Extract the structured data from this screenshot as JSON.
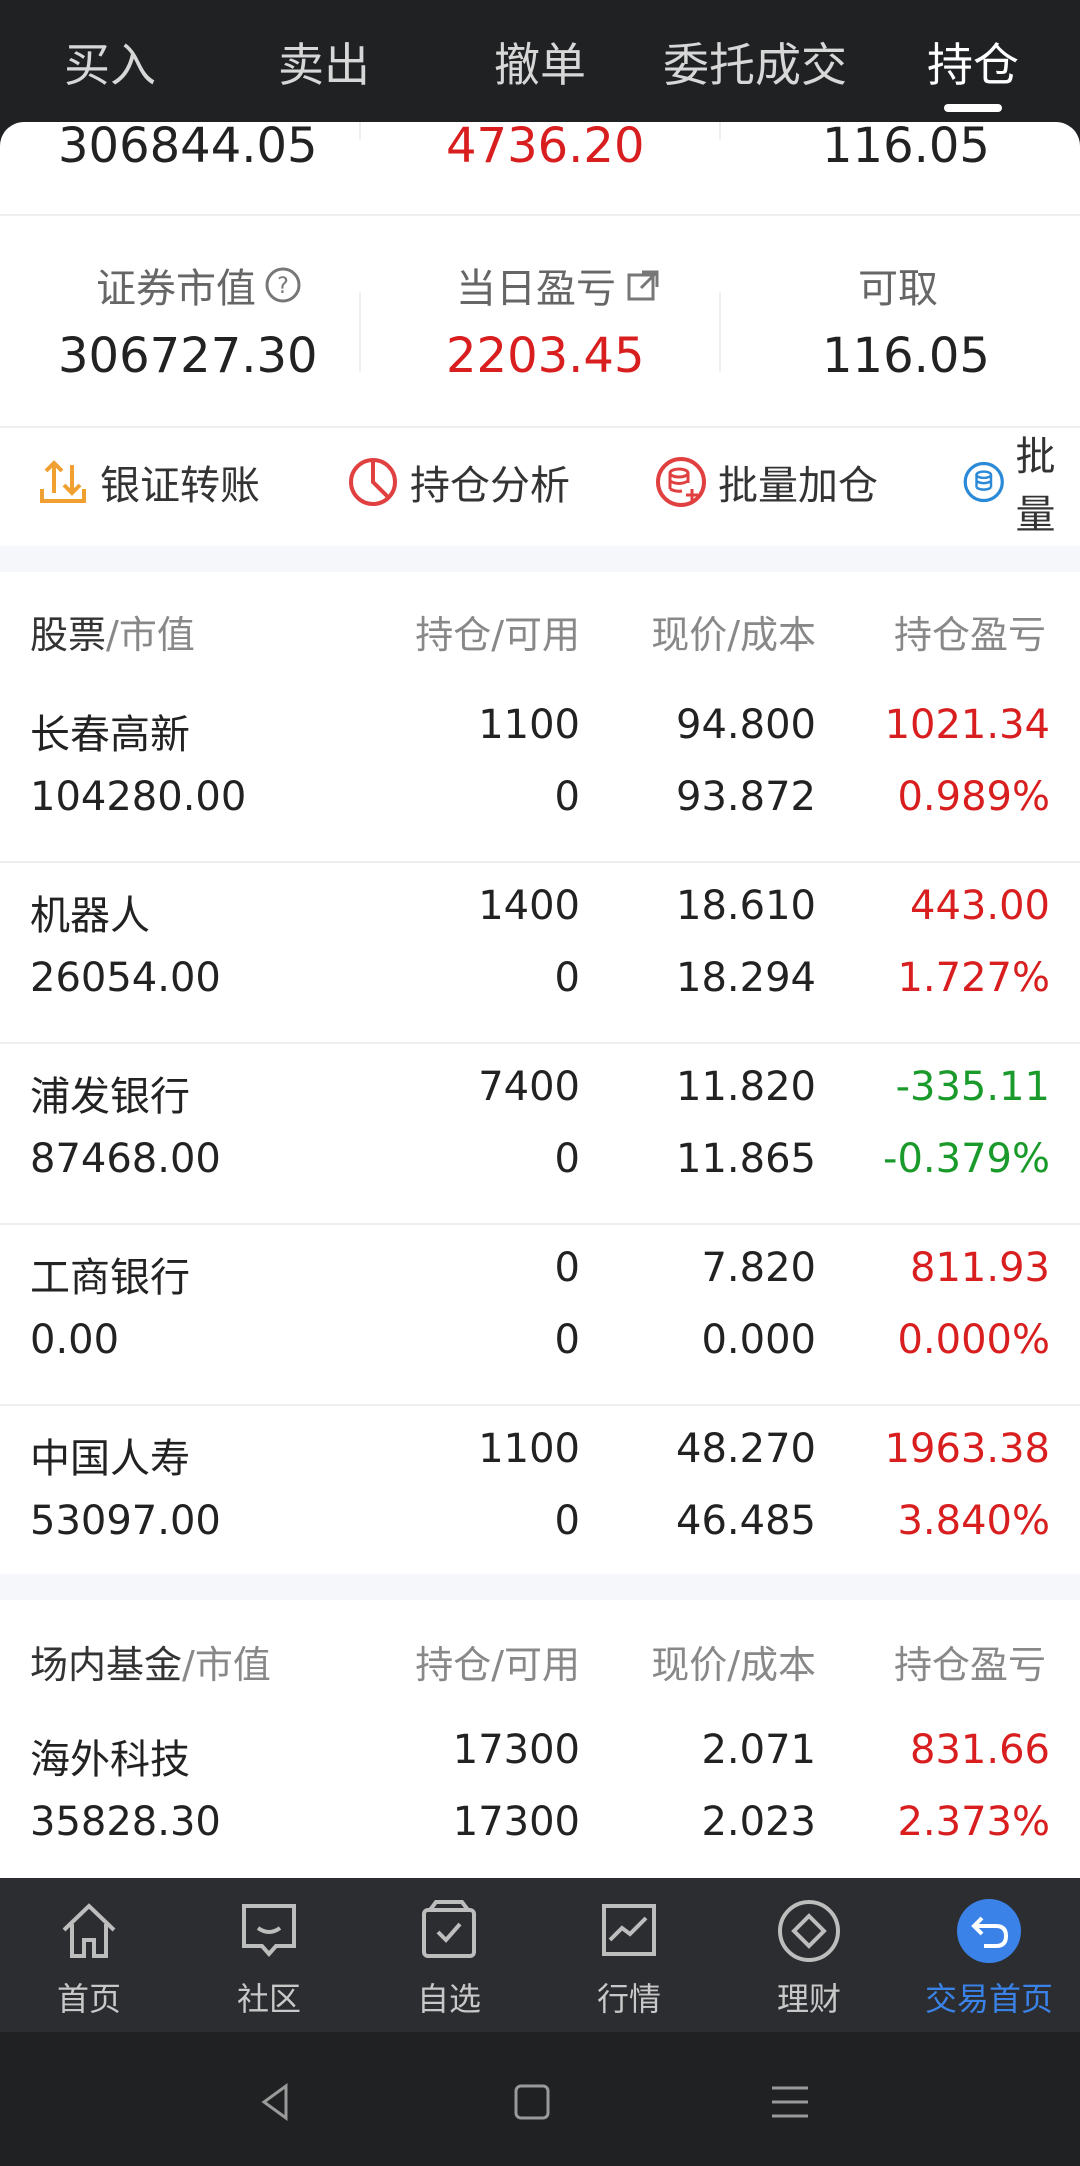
{
  "top_tabs": [
    "买入",
    "卖出",
    "撤单",
    "委托成交",
    "持仓"
  ],
  "summary": {
    "row1": {
      "total": "306844.05",
      "pnl": "4736.20",
      "avail": "116.05"
    },
    "row2_labels": {
      "market_value": "证券市值",
      "day_pnl": "当日盈亏",
      "withdrawable": "可取"
    },
    "row2": {
      "market_value": "306727.30",
      "day_pnl": "2203.45",
      "withdrawable": "116.05"
    }
  },
  "actions": [
    "银证转账",
    "持仓分析",
    "批量加仓",
    "批量"
  ],
  "stocks_header": {
    "name_strong": "股票",
    "name_rest": "/市值",
    "col2": "持仓/可用",
    "col3": "现价/成本",
    "col4": "持仓盈亏"
  },
  "stocks": [
    {
      "name": "长春高新",
      "mv": "104280.00",
      "hold": "1100",
      "avail": "0",
      "price": "94.800",
      "cost": "93.872",
      "pnl": "1021.34",
      "pct": "0.989%",
      "color": "red"
    },
    {
      "name": "机器人",
      "mv": "26054.00",
      "hold": "1400",
      "avail": "0",
      "price": "18.610",
      "cost": "18.294",
      "pnl": "443.00",
      "pct": "1.727%",
      "color": "red"
    },
    {
      "name": "浦发银行",
      "mv": "87468.00",
      "hold": "7400",
      "avail": "0",
      "price": "11.820",
      "cost": "11.865",
      "pnl": "-335.11",
      "pct": "-0.379%",
      "color": "green"
    },
    {
      "name": "工商银行",
      "mv": "0.00",
      "hold": "0",
      "avail": "0",
      "price": "7.820",
      "cost": "0.000",
      "pnl": "811.93",
      "pct": "0.000%",
      "color": "red"
    },
    {
      "name": "中国人寿",
      "mv": "53097.00",
      "hold": "1100",
      "avail": "0",
      "price": "48.270",
      "cost": "46.485",
      "pnl": "1963.38",
      "pct": "3.840%",
      "color": "red"
    }
  ],
  "funds_header": {
    "name_strong": "场内基金",
    "name_rest": "/市值",
    "col2": "持仓/可用",
    "col3": "现价/成本",
    "col4": "持仓盈亏"
  },
  "funds": [
    {
      "name": "海外科技",
      "mv": "35828.30",
      "hold": "17300",
      "avail": "17300",
      "price": "2.071",
      "cost": "2.023",
      "pnl": "831.66",
      "pct": "2.373%",
      "color": "red"
    }
  ],
  "bottom_nav": [
    "首页",
    "社区",
    "自选",
    "行情",
    "理财",
    "交易首页"
  ],
  "colors": {
    "red": "#d81e1e",
    "green": "#1a9a2a",
    "accent": "#3b82e8"
  }
}
